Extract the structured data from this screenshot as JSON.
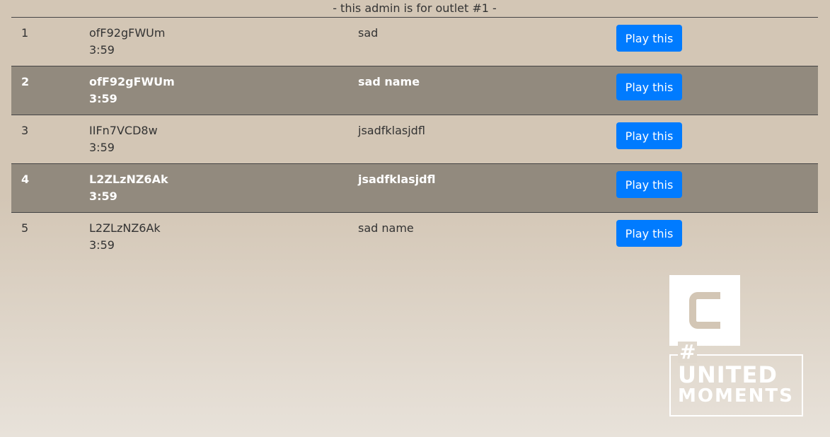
{
  "header": {
    "text": "- this admin is for outlet #1 -"
  },
  "rows": [
    {
      "num": "1",
      "id": "ofF92gFWUm",
      "duration": "3:59",
      "name": "sad",
      "button": "Play this"
    },
    {
      "num": "2",
      "id": "ofF92gFWUm",
      "duration": "3:59",
      "name": "sad name",
      "button": "Play this"
    },
    {
      "num": "3",
      "id": "IIFn7VCD8w",
      "duration": "3:59",
      "name": "jsadfklasjdfl",
      "button": "Play this"
    },
    {
      "num": "4",
      "id": "L2ZLzNZ6Ak",
      "duration": "3:59",
      "name": "jsadfklasjdfl",
      "button": "Play this"
    },
    {
      "num": "5",
      "id": "L2ZLzNZ6Ak",
      "duration": "3:59",
      "name": "sad name",
      "button": "Play this"
    }
  ],
  "brand": {
    "hash": "#",
    "line1": "UNITED",
    "line2": "MOMENTS"
  },
  "colors": {
    "background": "#d3c6b5",
    "alt_row": "#928a7e",
    "button": "#007bff",
    "logo": "#ffffff"
  }
}
